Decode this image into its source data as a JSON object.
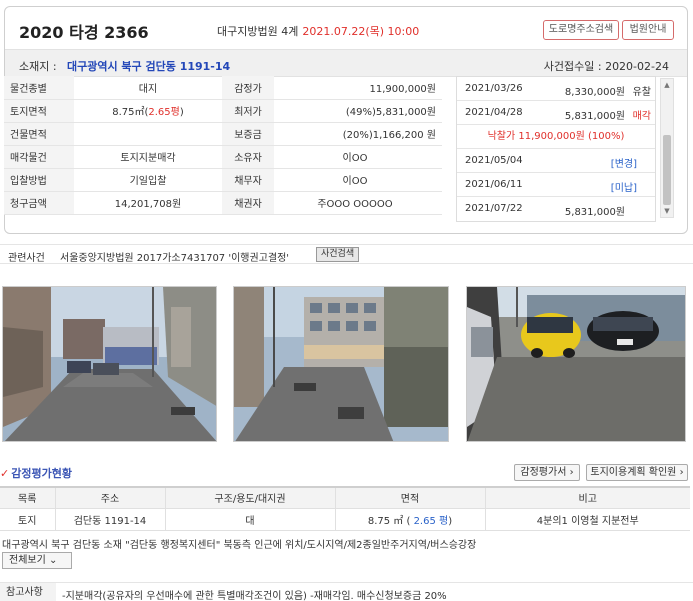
{
  "header": {
    "case_number": "2020 타경 2366",
    "court": "대구지방법원 4계",
    "auction_date": "2021.07.22(목) 10:00",
    "road_search_button": "도로명주소검색",
    "guide_button": "법원안내"
  },
  "address_bar": {
    "label": "소재지 :",
    "address": "대구광역시 북구 검단동 1191-14",
    "received": "사건접수일 : 2020-02-24"
  },
  "info": {
    "use_label": "물건종별",
    "use_value": "대지",
    "appraisal_label": "감정가",
    "appraisal_value": "11,900,000원",
    "land_label": "토지면적",
    "land_value_a": "8.75㎡(",
    "land_value_b": "2.65평",
    "land_value_c": ")",
    "min_label": "최저가",
    "min_value": "(49%)5,831,000원",
    "bldg_label": "건물면적",
    "bldg_value": "",
    "deposit_label": "보증금",
    "deposit_value": "(20%)1,166,200 원",
    "sale_label": "매각물건",
    "sale_value": "토지지분매각",
    "owner_label": "소유자",
    "owner_value": "이OO",
    "method_label": "입찰방법",
    "method_value": "기일입찰",
    "debtor_label": "채무자",
    "debtor_value": "이OO",
    "claim_label": "청구금액",
    "claim_value": "14,201,708원",
    "creditor_label": "채권자",
    "creditor_value": "주OOO OOOOO"
  },
  "history": {
    "r1_date": "2021/03/26",
    "r1_price": "8,330,000원",
    "r1_result": "유찰",
    "r2_date": "2021/04/28",
    "r2_price": "5,831,000원",
    "r2_result": "매각",
    "sold": "낙찰가 11,900,000원 (100%)",
    "r3_date": "2021/05/04",
    "r3_result": "[변경]",
    "r4_date": "2021/06/11",
    "r4_result": "[미납]",
    "r5_date": "2021/07/22",
    "r5_price": "5,831,000원"
  },
  "related": {
    "label": "관련사건",
    "value": "서울중앙지방법원 2017가소7431707 '이행권고결정'",
    "button": "사건검색"
  },
  "appraisal": {
    "title": "감정평가현황",
    "check": "✓",
    "report_button": "감정평가서 ›",
    "plan_button": "토지이용계획 확인원 ›",
    "h_item": "목록",
    "h_addr": "주소",
    "h_struct": "구조/용도/대지권",
    "h_area": "면적",
    "h_note": "비고",
    "r_item": "토지",
    "r_addr": "검단동 1191-14",
    "r_struct": "대",
    "r_area_a": "8.75 ㎡ (",
    "r_area_b": " 2.65 평",
    "r_area_c": ")",
    "r_note": "4분의1 이영철 지분전부",
    "desc": "대구광역시 북구 검단동 소재 \"검단동 행정복지센터\" 북동측 인근에 위치/도시지역/제2종일반주거지역/버스승강장",
    "expand": "전체보기 ⌄"
  },
  "note": {
    "label": "참고사항",
    "value": "-지분매각(공유자의 우선매수에 관한 특별매각조건이 있음) -재매각임. 매수신청보증금 20%"
  },
  "colors": {
    "accent_red": "#e0302b",
    "accent_blue": "#2a62c9",
    "title_blue": "#3c56b5"
  }
}
